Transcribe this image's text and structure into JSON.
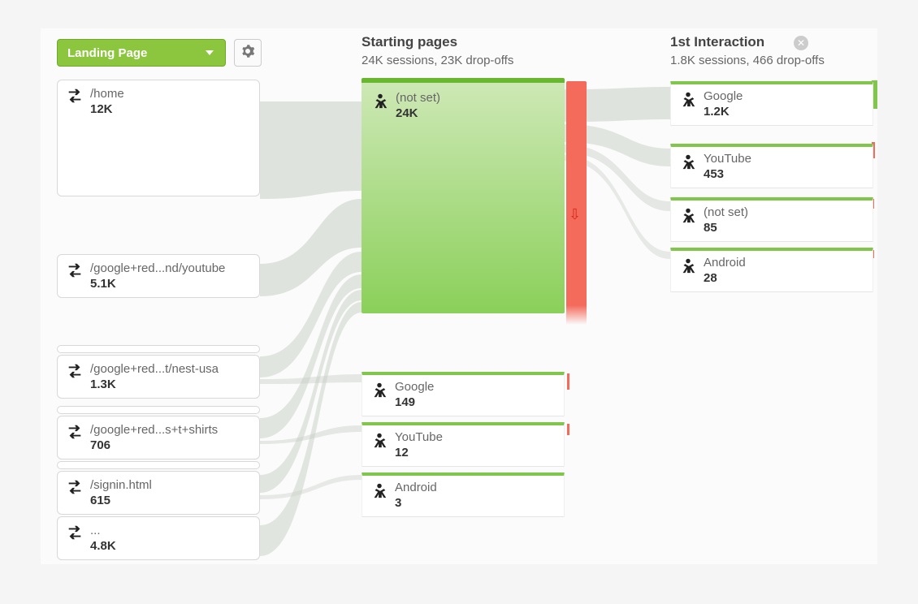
{
  "dimension_selector": {
    "label": "Landing Page"
  },
  "columns": {
    "starting": {
      "title": "Starting pages",
      "subtitle": "24K sessions, 23K drop-offs"
    },
    "first": {
      "title": "1st Interaction",
      "subtitle": "1.8K sessions, 466 drop-offs"
    }
  },
  "landing_pages": [
    {
      "label": "/home",
      "value": "12K"
    },
    {
      "label": "/google+red...nd/youtube",
      "value": "5.1K"
    },
    {
      "label": "/google+red...t/nest-usa",
      "value": "1.3K"
    },
    {
      "label": "/google+red...s+t+shirts",
      "value": "706"
    },
    {
      "label": "/signin.html",
      "value": "615"
    },
    {
      "label": "...",
      "value": "4.8K"
    }
  ],
  "starting_nodes": {
    "main": {
      "label": "(not set)",
      "value": "24K"
    },
    "secondary": [
      {
        "label": "Google",
        "value": "149"
      },
      {
        "label": "YouTube",
        "value": "12"
      },
      {
        "label": "Android",
        "value": "3"
      }
    ]
  },
  "first_interaction_nodes": [
    {
      "label": "Google",
      "value": "1.2K"
    },
    {
      "label": "YouTube",
      "value": "453"
    },
    {
      "label": "(not set)",
      "value": "85"
    },
    {
      "label": "Android",
      "value": "28"
    }
  ],
  "colors": {
    "flow": "#c7cfc6",
    "green": "#7fc64a",
    "red": "#f46a5b"
  }
}
